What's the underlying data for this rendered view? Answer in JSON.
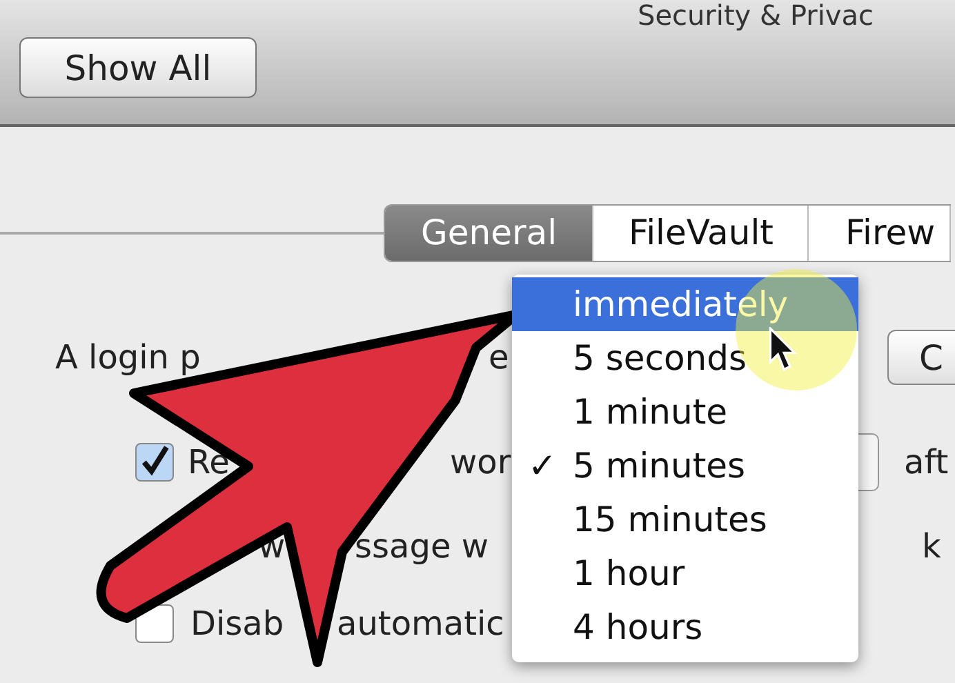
{
  "window": {
    "title": "Security & Privac"
  },
  "toolbar": {
    "show_all": "Show All"
  },
  "tabs": [
    {
      "label": "General",
      "selected": true
    },
    {
      "label": "FileVault",
      "selected": false
    },
    {
      "label": "Firew",
      "selected": false
    }
  ],
  "rows": [
    {
      "kind": "text",
      "left": "A login p",
      "middle": "e",
      "right": "C"
    },
    {
      "kind": "checkbox",
      "checked": true,
      "left": "Re",
      "middle": "wor",
      "right": "aft"
    },
    {
      "kind": "checkbox-hidden",
      "left": "w",
      "middle": "ssage w",
      "right": "k"
    },
    {
      "kind": "checkbox",
      "checked": false,
      "left": "Disab",
      "middle": "automatic"
    }
  ],
  "menu_mark": "✓",
  "menu": [
    {
      "label": "immediately",
      "selected": true,
      "checked": false
    },
    {
      "label": "5 seconds",
      "selected": false,
      "checked": false
    },
    {
      "label": "1 minute",
      "selected": false,
      "checked": false
    },
    {
      "label": "5 minutes",
      "selected": false,
      "checked": true
    },
    {
      "label": "15 minutes",
      "selected": false,
      "checked": false
    },
    {
      "label": "1 hour",
      "selected": false,
      "checked": false
    },
    {
      "label": "4 hours",
      "selected": false,
      "checked": false
    }
  ]
}
